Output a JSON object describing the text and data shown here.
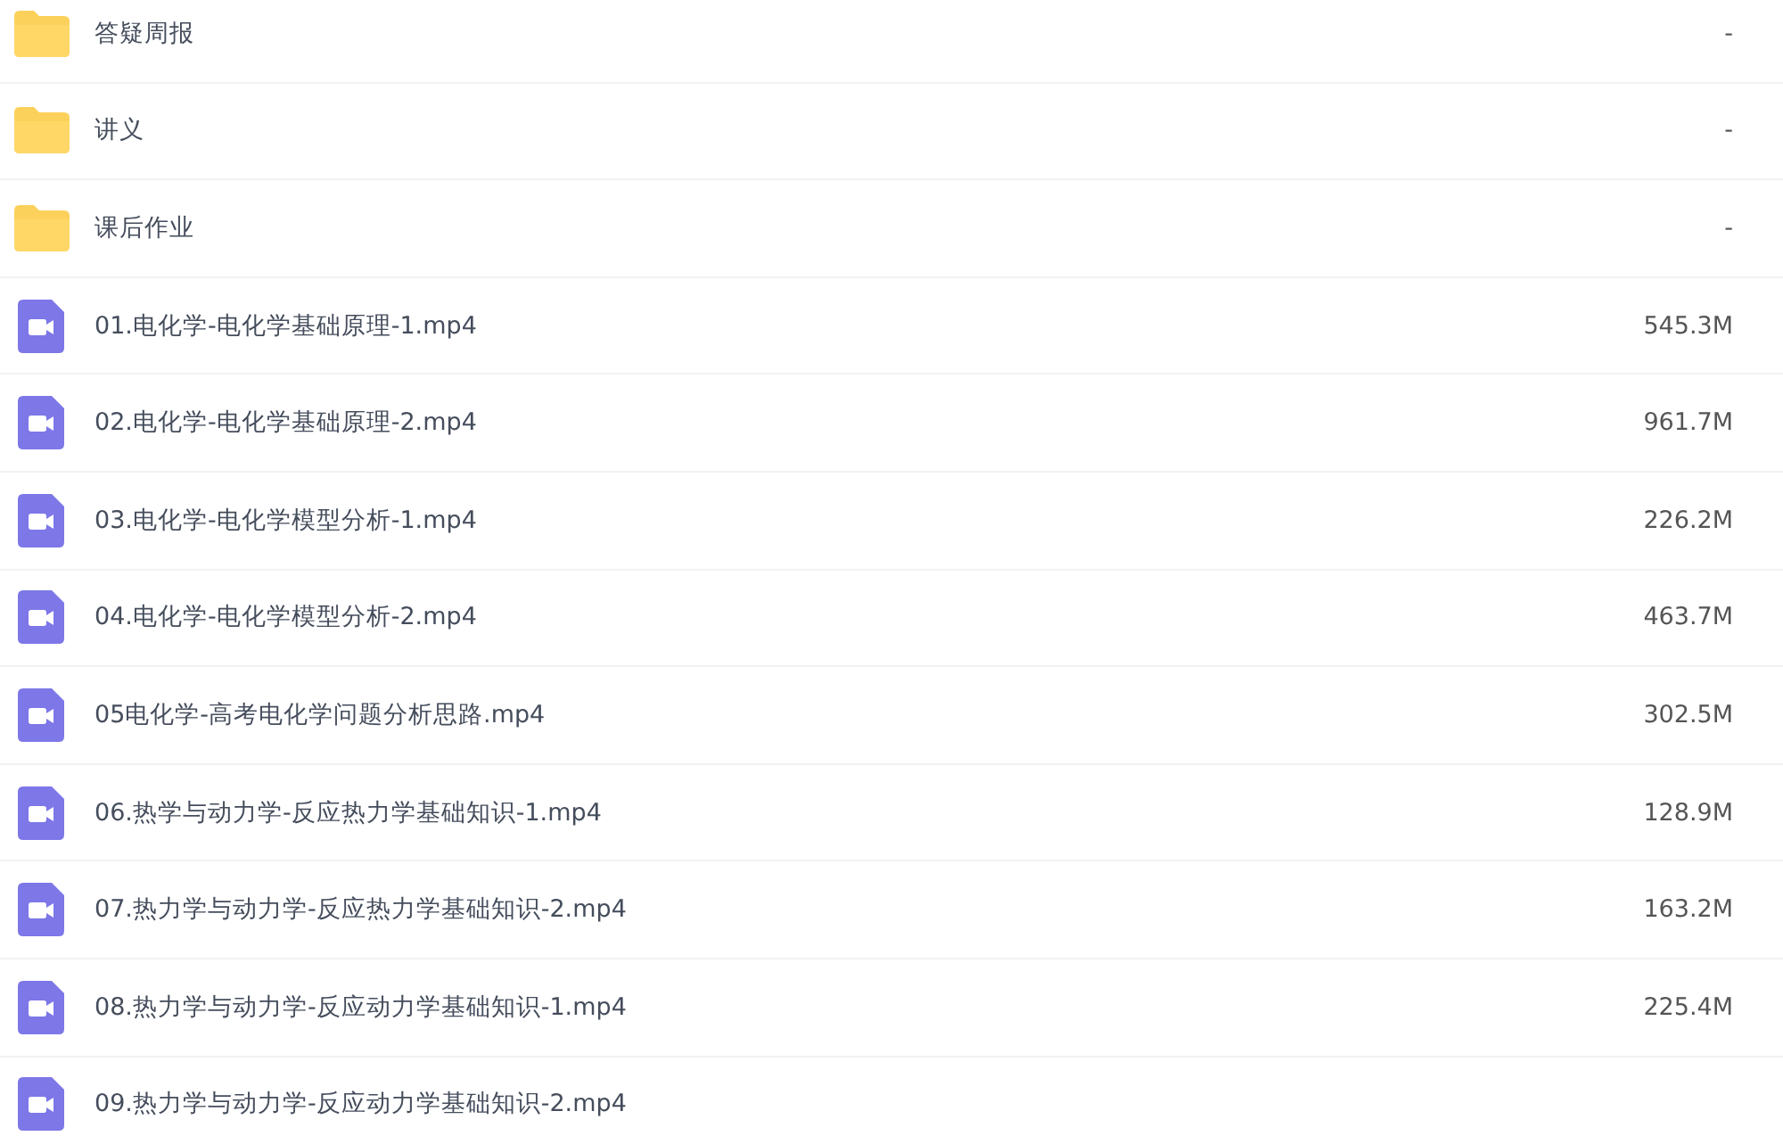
{
  "files": [
    {
      "kind": "folder",
      "name": "答疑周报",
      "size": "-"
    },
    {
      "kind": "folder",
      "name": "讲义",
      "size": "-"
    },
    {
      "kind": "folder",
      "name": "课后作业",
      "size": "-"
    },
    {
      "kind": "video",
      "name": "01.电化学-电化学基础原理-1.mp4",
      "size": "545.3M"
    },
    {
      "kind": "video",
      "name": "02.电化学-电化学基础原理-2.mp4",
      "size": "961.7M"
    },
    {
      "kind": "video",
      "name": "03.电化学-电化学模型分析-1.mp4",
      "size": "226.2M"
    },
    {
      "kind": "video",
      "name": "04.电化学-电化学模型分析-2.mp4",
      "size": "463.7M"
    },
    {
      "kind": "video",
      "name": "05电化学-高考电化学问题分析思路.mp4",
      "size": "302.5M"
    },
    {
      "kind": "video",
      "name": "06.热学与动力学-反应热力学基础知识-1.mp4",
      "size": "128.9M"
    },
    {
      "kind": "video",
      "name": "07.热力学与动力学-反应热力学基础知识-2.mp4",
      "size": "163.2M"
    },
    {
      "kind": "video",
      "name": "08.热力学与动力学-反应动力学基础知识-1.mp4",
      "size": "225.4M"
    },
    {
      "kind": "video",
      "name": "09.热力学与动力学-反应动力学基础知识-2.mp4"
    }
  ]
}
